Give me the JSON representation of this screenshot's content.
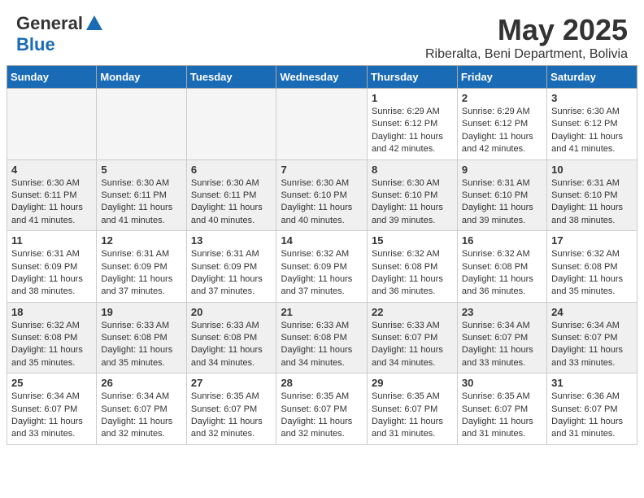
{
  "header": {
    "logo_general": "General",
    "logo_blue": "Blue",
    "month_title": "May 2025",
    "location": "Riberalta, Beni Department, Bolivia"
  },
  "days_of_week": [
    "Sunday",
    "Monday",
    "Tuesday",
    "Wednesday",
    "Thursday",
    "Friday",
    "Saturday"
  ],
  "weeks": [
    [
      {
        "day": "",
        "info": "",
        "empty": true
      },
      {
        "day": "",
        "info": "",
        "empty": true
      },
      {
        "day": "",
        "info": "",
        "empty": true
      },
      {
        "day": "",
        "info": "",
        "empty": true
      },
      {
        "day": "1",
        "info": "Sunrise: 6:29 AM\nSunset: 6:12 PM\nDaylight: 11 hours\nand 42 minutes."
      },
      {
        "day": "2",
        "info": "Sunrise: 6:29 AM\nSunset: 6:12 PM\nDaylight: 11 hours\nand 42 minutes."
      },
      {
        "day": "3",
        "info": "Sunrise: 6:30 AM\nSunset: 6:12 PM\nDaylight: 11 hours\nand 41 minutes."
      }
    ],
    [
      {
        "day": "4",
        "info": "Sunrise: 6:30 AM\nSunset: 6:11 PM\nDaylight: 11 hours\nand 41 minutes."
      },
      {
        "day": "5",
        "info": "Sunrise: 6:30 AM\nSunset: 6:11 PM\nDaylight: 11 hours\nand 41 minutes."
      },
      {
        "day": "6",
        "info": "Sunrise: 6:30 AM\nSunset: 6:11 PM\nDaylight: 11 hours\nand 40 minutes."
      },
      {
        "day": "7",
        "info": "Sunrise: 6:30 AM\nSunset: 6:10 PM\nDaylight: 11 hours\nand 40 minutes."
      },
      {
        "day": "8",
        "info": "Sunrise: 6:30 AM\nSunset: 6:10 PM\nDaylight: 11 hours\nand 39 minutes."
      },
      {
        "day": "9",
        "info": "Sunrise: 6:31 AM\nSunset: 6:10 PM\nDaylight: 11 hours\nand 39 minutes."
      },
      {
        "day": "10",
        "info": "Sunrise: 6:31 AM\nSunset: 6:10 PM\nDaylight: 11 hours\nand 38 minutes."
      }
    ],
    [
      {
        "day": "11",
        "info": "Sunrise: 6:31 AM\nSunset: 6:09 PM\nDaylight: 11 hours\nand 38 minutes."
      },
      {
        "day": "12",
        "info": "Sunrise: 6:31 AM\nSunset: 6:09 PM\nDaylight: 11 hours\nand 37 minutes."
      },
      {
        "day": "13",
        "info": "Sunrise: 6:31 AM\nSunset: 6:09 PM\nDaylight: 11 hours\nand 37 minutes."
      },
      {
        "day": "14",
        "info": "Sunrise: 6:32 AM\nSunset: 6:09 PM\nDaylight: 11 hours\nand 37 minutes."
      },
      {
        "day": "15",
        "info": "Sunrise: 6:32 AM\nSunset: 6:08 PM\nDaylight: 11 hours\nand 36 minutes."
      },
      {
        "day": "16",
        "info": "Sunrise: 6:32 AM\nSunset: 6:08 PM\nDaylight: 11 hours\nand 36 minutes."
      },
      {
        "day": "17",
        "info": "Sunrise: 6:32 AM\nSunset: 6:08 PM\nDaylight: 11 hours\nand 35 minutes."
      }
    ],
    [
      {
        "day": "18",
        "info": "Sunrise: 6:32 AM\nSunset: 6:08 PM\nDaylight: 11 hours\nand 35 minutes."
      },
      {
        "day": "19",
        "info": "Sunrise: 6:33 AM\nSunset: 6:08 PM\nDaylight: 11 hours\nand 35 minutes."
      },
      {
        "day": "20",
        "info": "Sunrise: 6:33 AM\nSunset: 6:08 PM\nDaylight: 11 hours\nand 34 minutes."
      },
      {
        "day": "21",
        "info": "Sunrise: 6:33 AM\nSunset: 6:08 PM\nDaylight: 11 hours\nand 34 minutes."
      },
      {
        "day": "22",
        "info": "Sunrise: 6:33 AM\nSunset: 6:07 PM\nDaylight: 11 hours\nand 34 minutes."
      },
      {
        "day": "23",
        "info": "Sunrise: 6:34 AM\nSunset: 6:07 PM\nDaylight: 11 hours\nand 33 minutes."
      },
      {
        "day": "24",
        "info": "Sunrise: 6:34 AM\nSunset: 6:07 PM\nDaylight: 11 hours\nand 33 minutes."
      }
    ],
    [
      {
        "day": "25",
        "info": "Sunrise: 6:34 AM\nSunset: 6:07 PM\nDaylight: 11 hours\nand 33 minutes."
      },
      {
        "day": "26",
        "info": "Sunrise: 6:34 AM\nSunset: 6:07 PM\nDaylight: 11 hours\nand 32 minutes."
      },
      {
        "day": "27",
        "info": "Sunrise: 6:35 AM\nSunset: 6:07 PM\nDaylight: 11 hours\nand 32 minutes."
      },
      {
        "day": "28",
        "info": "Sunrise: 6:35 AM\nSunset: 6:07 PM\nDaylight: 11 hours\nand 32 minutes."
      },
      {
        "day": "29",
        "info": "Sunrise: 6:35 AM\nSunset: 6:07 PM\nDaylight: 11 hours\nand 31 minutes."
      },
      {
        "day": "30",
        "info": "Sunrise: 6:35 AM\nSunset: 6:07 PM\nDaylight: 11 hours\nand 31 minutes."
      },
      {
        "day": "31",
        "info": "Sunrise: 6:36 AM\nSunset: 6:07 PM\nDaylight: 11 hours\nand 31 minutes."
      }
    ]
  ]
}
